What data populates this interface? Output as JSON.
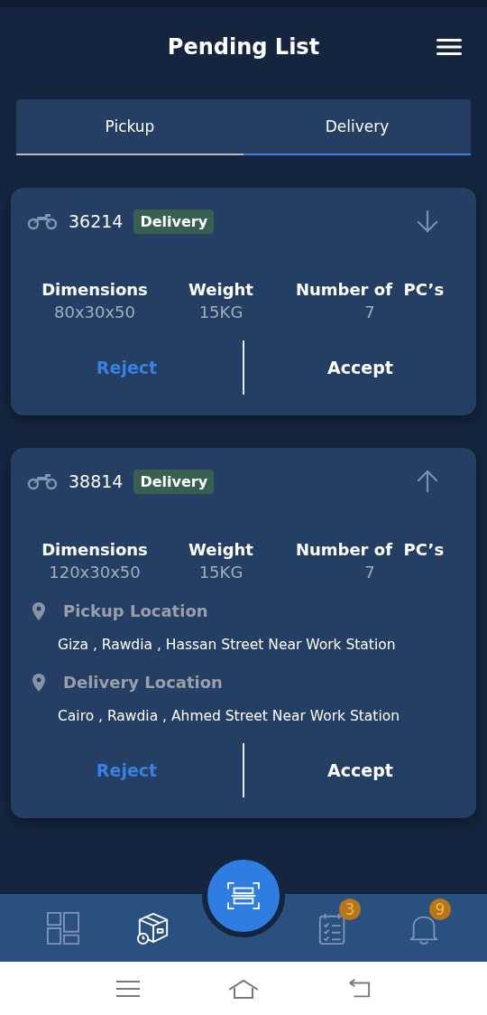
{
  "header": {
    "title": "Pending List"
  },
  "tabs": [
    {
      "label": "Pickup",
      "selected": false
    },
    {
      "label": "Delivery",
      "selected": true
    }
  ],
  "orders": [
    {
      "id": "36214",
      "tag": "Delivery",
      "expanded": false,
      "specs": [
        {
          "label": "Dimensions",
          "value": "80x30x50"
        },
        {
          "label": "Weight",
          "value": "15KG"
        },
        {
          "label": "Number of  PC’s",
          "value": "7"
        }
      ],
      "reject": "Reject",
      "accept": "Accept"
    },
    {
      "id": "38814",
      "tag": "Delivery",
      "expanded": true,
      "specs": [
        {
          "label": "Dimensions",
          "value": "120x30x50"
        },
        {
          "label": "Weight",
          "value": "15KG"
        },
        {
          "label": "Number of  PC’s",
          "value": "7"
        }
      ],
      "locations": [
        {
          "label": "Pickup Location",
          "address": "Giza , Rawdia , Hassan Street Near Work Station"
        },
        {
          "label": "Delivery Location",
          "address": "Cairo , Rawdia , Ahmed Street Near Work Station"
        }
      ],
      "reject": "Reject",
      "accept": "Accept"
    }
  ],
  "bottom_nav": [
    {
      "kind": "dashboard",
      "selected": false
    },
    {
      "kind": "packages",
      "selected": true
    },
    {
      "kind": "scan",
      "selected": false
    },
    {
      "kind": "tasks",
      "selected": false,
      "badge": "3"
    },
    {
      "kind": "notifications",
      "selected": false,
      "badge": "9"
    }
  ]
}
